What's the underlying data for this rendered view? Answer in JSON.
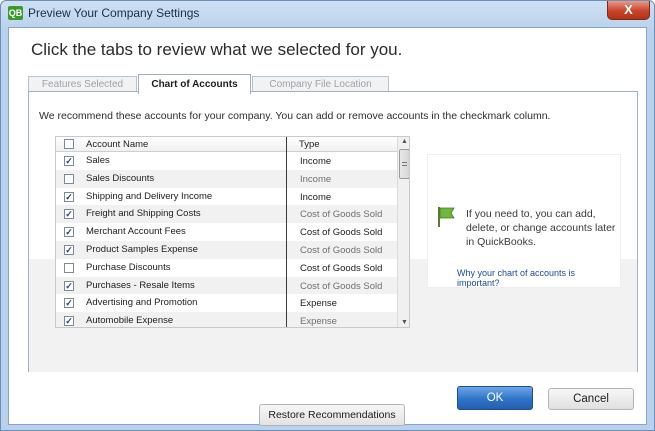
{
  "window": {
    "title": "Preview Your Company Settings",
    "close_glyph": "X",
    "app_icon": "qb-icon"
  },
  "headline": "Click the tabs to review what we selected for you.",
  "tabs": [
    {
      "label": "Features Selected",
      "active": false
    },
    {
      "label": "Chart of Accounts",
      "active": true
    },
    {
      "label": "Company File Location",
      "active": false
    }
  ],
  "recommend_text": "We recommend these accounts for your company. You can add or remove accounts in the checkmark column.",
  "grid": {
    "columns": [
      "Account Name",
      "Type"
    ],
    "rows": [
      {
        "checked": true,
        "name": "Sales",
        "type": "Income",
        "muted": false
      },
      {
        "checked": false,
        "name": "Sales Discounts",
        "type": "Income",
        "muted": true
      },
      {
        "checked": true,
        "name": "Shipping and Delivery Income",
        "type": "Income",
        "muted": false
      },
      {
        "checked": true,
        "name": "Freight and Shipping Costs",
        "type": "Cost of Goods Sold",
        "muted": true
      },
      {
        "checked": true,
        "name": "Merchant Account Fees",
        "type": "Cost of Goods Sold",
        "muted": false
      },
      {
        "checked": true,
        "name": "Product Samples Expense",
        "type": "Cost of Goods Sold",
        "muted": true
      },
      {
        "checked": false,
        "name": "Purchase Discounts",
        "type": "Cost of Goods Sold",
        "muted": false
      },
      {
        "checked": true,
        "name": "Purchases - Resale Items",
        "type": "Cost of Goods Sold",
        "muted": true
      },
      {
        "checked": true,
        "name": "Advertising and Promotion",
        "type": "Expense",
        "muted": false
      },
      {
        "checked": true,
        "name": "Automobile Expense",
        "type": "Expense",
        "muted": true
      }
    ]
  },
  "side": {
    "info": "If you need to, you can add, delete, or change accounts later in QuickBooks.",
    "link": "Why your chart of accounts is important?"
  },
  "buttons": {
    "restore": "Restore Recommendations",
    "ok": "OK",
    "cancel": "Cancel"
  },
  "colors": {
    "ok_blue": "#2f73c8",
    "flag_green": "#6fb83a",
    "link_blue": "#1a4a9a"
  }
}
